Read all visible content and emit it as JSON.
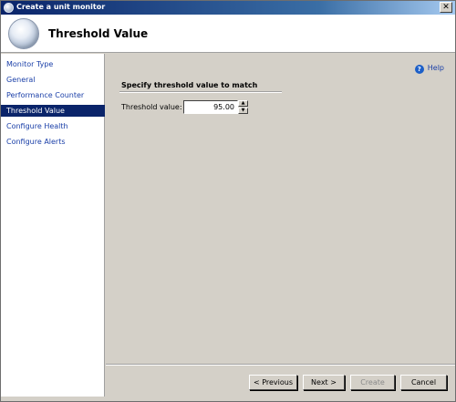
{
  "window": {
    "title": "Create a unit monitor",
    "close_glyph": "✕"
  },
  "header": {
    "title": "Threshold Value",
    "icon": "monitor-wizard-icon"
  },
  "sidebar": {
    "items": [
      {
        "label": "Monitor Type"
      },
      {
        "label": "General"
      },
      {
        "label": "Performance Counter"
      },
      {
        "label": "Threshold Value",
        "active": true
      },
      {
        "label": "Configure Health"
      },
      {
        "label": "Configure Alerts"
      }
    ]
  },
  "content": {
    "help_label": "Help",
    "help_glyph": "?",
    "section_heading": "Specify threshold value to match",
    "threshold_label": "Threshold value:",
    "threshold_value": "95.00"
  },
  "buttons": {
    "previous": "< Previous",
    "next": "Next >",
    "create": "Create",
    "cancel": "Cancel"
  },
  "colors": {
    "selection": "#0a246a",
    "link": "#1a3fa8",
    "chrome": "#d4d0c8"
  }
}
